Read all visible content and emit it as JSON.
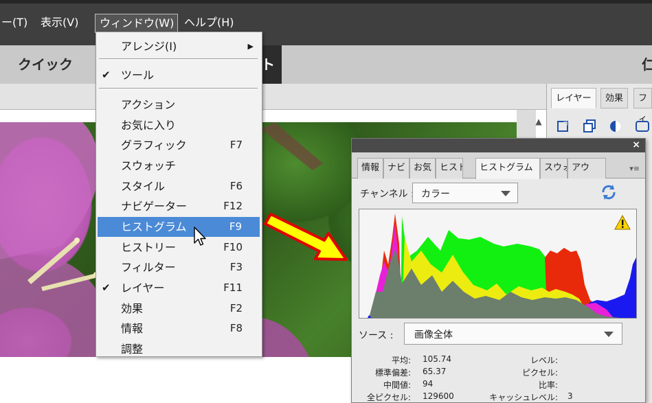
{
  "menubar": {
    "items": [
      {
        "label": "ー(T)"
      },
      {
        "label": "表示(V)"
      },
      {
        "label": "ウィンドウ(W)"
      },
      {
        "label": "ヘルプ(H)"
      }
    ]
  },
  "modebar": {
    "quick": "クイック",
    "dark_fragment": "ト",
    "right_fragment": "仁"
  },
  "window_menu": {
    "items": [
      {
        "label": "アレンジ(I)",
        "submenu": true
      },
      {
        "label": "ツール",
        "checked": true
      },
      {
        "label": "アクション"
      },
      {
        "label": "お気に入り"
      },
      {
        "label": "グラフィック",
        "key": "F7"
      },
      {
        "label": "スウォッチ"
      },
      {
        "label": "スタイル",
        "key": "F6"
      },
      {
        "label": "ナビゲーター",
        "key": "F12"
      },
      {
        "label": "ヒストグラム",
        "key": "F9",
        "highlighted": true
      },
      {
        "label": "ヒストリー",
        "key": "F10"
      },
      {
        "label": "フィルター",
        "key": "F3"
      },
      {
        "label": "レイヤー",
        "key": "F11",
        "checked": true
      },
      {
        "label": "効果",
        "key": "F2"
      },
      {
        "label": "情報",
        "key": "F8"
      },
      {
        "label": "調整"
      }
    ]
  },
  "right_panel": {
    "tabs": [
      "レイヤー",
      "効果",
      "フィ"
    ]
  },
  "histogram_panel": {
    "close": "×",
    "tabs": [
      "情報",
      "ナビ",
      "お気",
      "ヒスト",
      "ヒストグラム",
      "スウォ",
      "アウ"
    ],
    "menu_glyph": "▾≡",
    "channel_label": "チャンネル :",
    "channel_value": "カラー",
    "source_label": "ソース :",
    "source_value": "画像全体",
    "stats_left": [
      {
        "label": "平均:",
        "value": "105.74"
      },
      {
        "label": "標準偏差:",
        "value": "65.37"
      },
      {
        "label": "中間値:",
        "value": "94"
      },
      {
        "label": "全ピクセル:",
        "value": "129600"
      }
    ],
    "stats_right": [
      {
        "label": "レベル:",
        "value": ""
      },
      {
        "label": "ピクセル:",
        "value": ""
      },
      {
        "label": "比率:",
        "value": ""
      },
      {
        "label": "キャッシュレベル:",
        "value": "3"
      }
    ]
  },
  "colors": {
    "menubar": "#3f3f3f",
    "highlight": "#4b8ad6",
    "arrow_fill": "#ffff00",
    "arrow_stroke": "#e00000",
    "hist_gray": "#6c7e6c",
    "hist_yellow": "#ecec10",
    "hist_green": "#12f012",
    "hist_red": "#e82a0a",
    "hist_magenta": "#e820d8",
    "hist_blue": "#1a1af0"
  }
}
